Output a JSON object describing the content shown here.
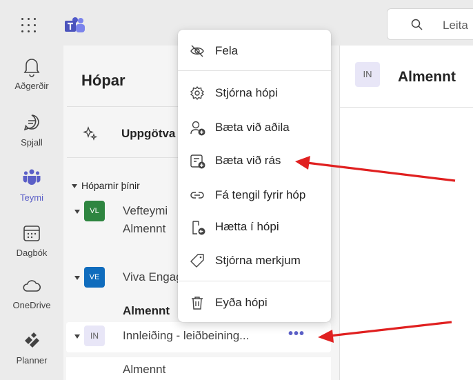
{
  "rail": {
    "items": [
      {
        "label": "Aðgerðir",
        "icon": "bell-icon"
      },
      {
        "label": "Spjall",
        "icon": "chat-icon"
      },
      {
        "label": "Teymi",
        "icon": "teams-icon"
      },
      {
        "label": "Dagbók",
        "icon": "calendar-icon"
      },
      {
        "label": "OneDrive",
        "icon": "cloud-icon"
      },
      {
        "label": "Planner",
        "icon": "planner-icon"
      }
    ]
  },
  "search": {
    "placeholder": "Leita"
  },
  "panel": {
    "title": "Hópar",
    "discover": "Uppgötva",
    "section": "Hóparnir þínir",
    "teams": [
      {
        "initials": "VL",
        "name": "Vefteymi",
        "color": "#2e8540",
        "channel": "Almennt"
      },
      {
        "initials": "VE",
        "name": "Viva Engage",
        "color": "#0f6cbd",
        "channel": "Almennt"
      },
      {
        "initials": "IN",
        "name": "Innleiðing - leiðbeining...",
        "color": "#e8e6f7",
        "channel": "Almennt"
      }
    ],
    "more": "•••"
  },
  "main": {
    "avatar": "IN",
    "title": "Almennt"
  },
  "menu": {
    "items": [
      {
        "label": "Fela",
        "icon": "eye-off-icon"
      },
      {
        "label": "Stjórna hópi",
        "icon": "gear-icon"
      },
      {
        "label": "Bæta við aðila",
        "icon": "person-add-icon"
      },
      {
        "label": "Bæta við rás",
        "icon": "channel-add-icon"
      },
      {
        "label": "Fá tengil fyrir hóp",
        "icon": "link-icon"
      },
      {
        "label": "Hætta í hópi",
        "icon": "leave-icon"
      },
      {
        "label": "Stjórna merkjum",
        "icon": "tag-icon"
      },
      {
        "label": "Eyða hópi",
        "icon": "trash-icon"
      }
    ]
  },
  "colors": {
    "accent": "#5b5fc7",
    "annotation": "#e02020"
  }
}
